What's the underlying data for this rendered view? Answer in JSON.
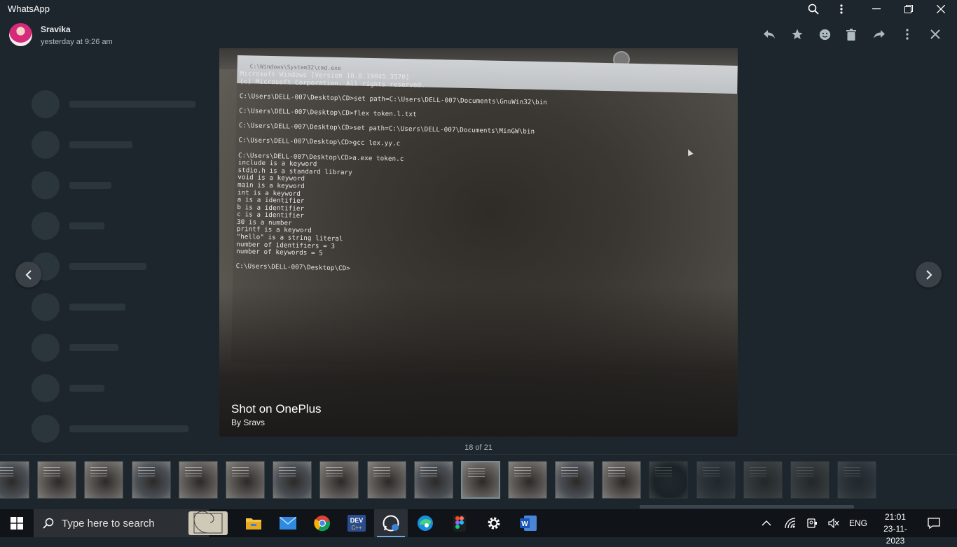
{
  "window": {
    "title": "WhatsApp"
  },
  "header": {
    "sender": "Sravika",
    "time": "yesterday at 9:26 am",
    "actions": [
      "reply-icon",
      "star-icon",
      "emoji-icon",
      "delete-icon",
      "forward-icon",
      "more-icon",
      "close-icon"
    ]
  },
  "photo": {
    "cmd_title": "C:\\Windows\\System32\\cmd.exe",
    "cmd_lines": [
      "Microsoft Windows [Version 10.0.19045.3570]",
      "(c) Microsoft Corporation. All rights reserved.",
      "",
      "C:\\Users\\DELL-007\\Desktop\\CD>set path=C:\\Users\\DELL-007\\Documents\\GnuWin32\\bin",
      "",
      "C:\\Users\\DELL-007\\Desktop\\CD>flex token.l.txt",
      "",
      "C:\\Users\\DELL-007\\Desktop\\CD>set path=C:\\Users\\DELL-007\\Documents\\MinGW\\bin",
      "",
      "C:\\Users\\DELL-007\\Desktop\\CD>gcc lex.yy.c",
      "",
      "C:\\Users\\DELL-007\\Desktop\\CD>a.exe token.c",
      "include is a keyword",
      "stdio.h is a standard library",
      "void is a keyword",
      "main is a keyword",
      "int is a keyword",
      "a is a identifier",
      "b is a identifier",
      "c is a identifier",
      "30 is a number",
      "printf is a keyword",
      "\"hello\" is a string literal",
      "number of identifiers = 3",
      "number of keywords = 5",
      "",
      "C:\\Users\\DELL-007\\Desktop\\CD>"
    ],
    "caption_title": "Shot on OnePlus",
    "caption_author": "By Sravs"
  },
  "counter": "18 of 21",
  "taskbar": {
    "search_placeholder": "Type here to search",
    "language": "ENG",
    "time": "21:01",
    "date": "23-11-2023"
  },
  "colors": {
    "accent": "#6ea8dc",
    "background": "#1d262c"
  }
}
